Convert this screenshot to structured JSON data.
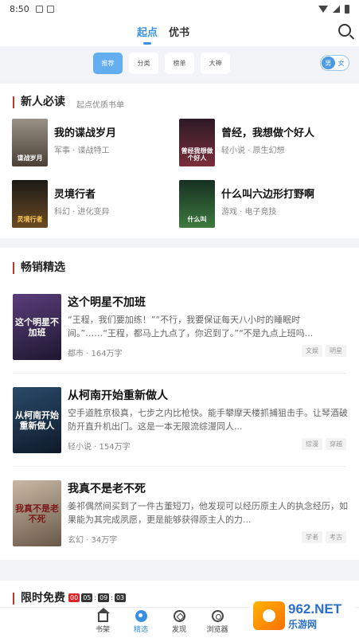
{
  "status_bar": {
    "time": "8:50"
  },
  "top_tabs": [
    {
      "label": "起点",
      "active": true
    },
    {
      "label": "优书",
      "active": false
    }
  ],
  "chips": [
    {
      "label": "推荐",
      "active": true
    },
    {
      "label": "分类",
      "active": false
    },
    {
      "label": "榜单",
      "active": false
    },
    {
      "label": "大神",
      "active": false
    }
  ],
  "gender_toggle": {
    "male": "男",
    "female": "女",
    "selected": "男"
  },
  "new_reader": {
    "title": "新人必读",
    "subtitle": "起点优质书单",
    "books": [
      {
        "title": "我的谍战岁月",
        "meta": "军事 · 谍战特工",
        "cover_text": "谍战岁月",
        "cover_color": "#5b5146"
      },
      {
        "title": "曾经，我想做个好人",
        "meta": "轻小说 · 原生幻想",
        "cover_text": "曾经我想做个好人",
        "cover_color": "#3b1e2a"
      },
      {
        "title": "灵境行者",
        "meta": "科幻 · 进化变异",
        "cover_text": "灵境行者",
        "cover_color": "#2b2620"
      },
      {
        "title": "什么叫六边形打野啊",
        "meta": "游戏 · 电子竞技",
        "cover_text": "什么叫",
        "cover_color": "#1f3a2a"
      }
    ]
  },
  "bestsellers": {
    "title": "畅销精选",
    "books": [
      {
        "title": "这个明星不加班",
        "desc": "“王程，我们要加练！”“不行，我要保证每天八小时的睡眠时间。”……“王程，都马上九点了，你迟到了。”“不是九点上班吗...",
        "meta": "都市 · 164万字",
        "tags": [
          "文娱",
          "明星"
        ],
        "cover_text": "这个明星不加班",
        "cover_color": "#3a2d52"
      },
      {
        "title": "从柯南开始重新做人",
        "desc": "空手道胜京极真，七步之内比枪快。能手攀摩天楼抓捕狙击手。让琴酒破防开直升机出门。这是一本无限流综漫同人...",
        "meta": "轻小说 · 154万字",
        "tags": [
          "综漫",
          "穿越"
        ],
        "cover_text": "从柯南开始重新做人",
        "cover_color": "#1e3550"
      },
      {
        "title": "我真不是老不死",
        "desc": "姜祁偶然间买到了一件古董短刀，他发现可以经历原主人的执念经历，如果能为其完成夙愿，更是能够获得原主人的力...",
        "meta": "玄幻 · 34万字",
        "tags": [
          "学者",
          "考古"
        ],
        "cover_text": "我真不是老不死",
        "cover_color": "#8a7a6a"
      }
    ]
  },
  "limited_free": {
    "title": "限时免费",
    "countdown": [
      "00",
      "05",
      "09",
      "03"
    ]
  },
  "bottom_nav": [
    {
      "label": "书架",
      "icon": "bookshelf-icon",
      "active": false
    },
    {
      "label": "精选",
      "icon": "featured-icon",
      "active": true
    },
    {
      "label": "发现",
      "icon": "discover-icon",
      "active": false
    },
    {
      "label": "浏览器",
      "icon": "browser-icon",
      "active": false
    }
  ],
  "watermark": {
    "top": "962.NET",
    "bottom": "乐游网"
  }
}
